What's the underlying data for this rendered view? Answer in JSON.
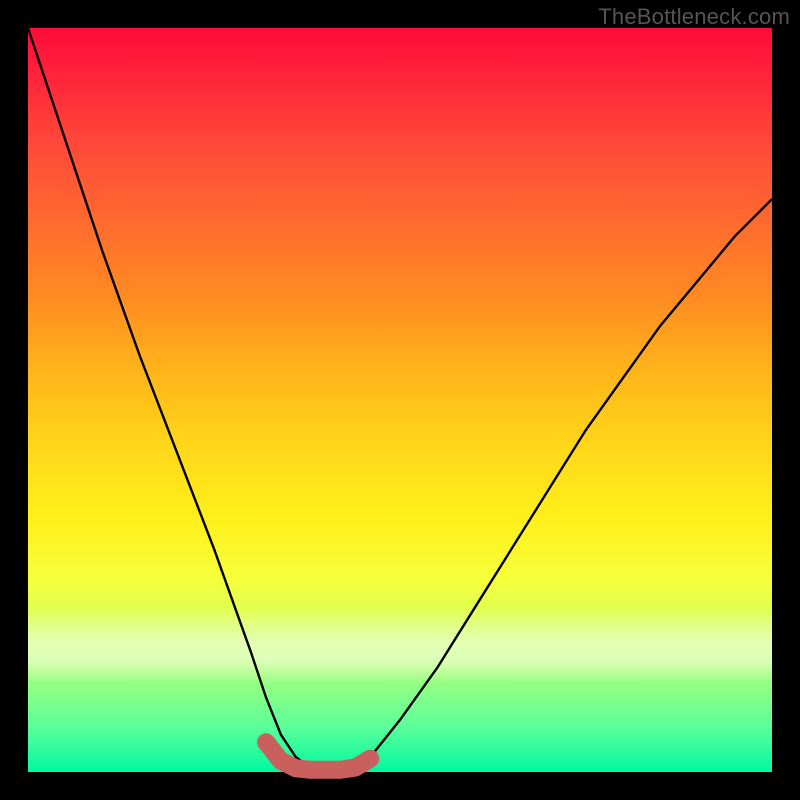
{
  "watermark": "TheBottleneck.com",
  "chart_data": {
    "type": "line",
    "title": "",
    "xlabel": "",
    "ylabel": "",
    "xlim": [
      0,
      100
    ],
    "ylim": [
      0,
      100
    ],
    "grid": false,
    "legend": false,
    "series": [
      {
        "name": "bottleneck-curve",
        "x": [
          0,
          5,
          10,
          15,
          20,
          25,
          30,
          32,
          34,
          36,
          38,
          40,
          42,
          44,
          46,
          50,
          55,
          60,
          65,
          70,
          75,
          80,
          85,
          90,
          95,
          100
        ],
        "values": [
          100,
          85,
          70,
          56,
          43,
          30,
          16,
          10,
          5,
          2,
          0.5,
          0,
          0,
          0.5,
          2,
          7,
          14,
          22,
          30,
          38,
          46,
          53,
          60,
          66,
          72,
          77
        ]
      },
      {
        "name": "bottleneck-flat-marker",
        "x": [
          32,
          34,
          36,
          38,
          40,
          42,
          44,
          46
        ],
        "values": [
          4,
          1.5,
          0.5,
          0.3,
          0.3,
          0.3,
          0.6,
          1.8
        ]
      }
    ],
    "colors": {
      "curve": "#000000",
      "marker": "#c9605e",
      "gradient_top": "#ff0a3a",
      "gradient_bottom": "#00f8a0"
    }
  }
}
